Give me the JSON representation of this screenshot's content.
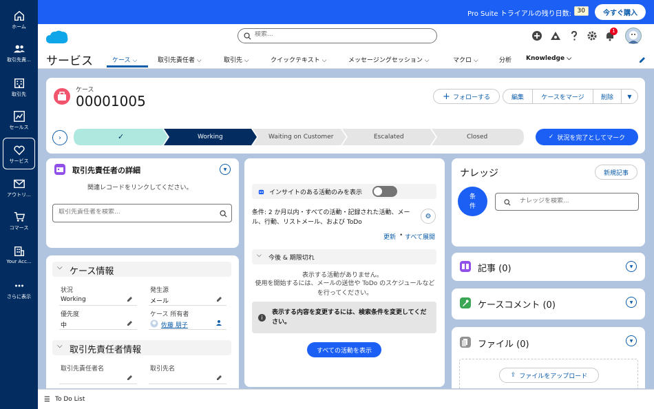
{
  "rail": {
    "items": [
      {
        "label": "ホーム",
        "icon": "home-icon"
      },
      {
        "label": "取引先責...",
        "icon": "contacts-icon"
      },
      {
        "label": "取引先",
        "icon": "accounts-icon"
      },
      {
        "label": "セールス",
        "icon": "sales-chart-icon"
      },
      {
        "label": "サービス",
        "icon": "heart-icon"
      },
      {
        "label": "アウトリ...",
        "icon": "mail-icon"
      },
      {
        "label": "コマース",
        "icon": "cart-icon"
      },
      {
        "label": "Your Acc...",
        "icon": "building-icon"
      },
      {
        "label": "さらに表示",
        "icon": "more-icon"
      }
    ]
  },
  "banner": {
    "trial_text": "Pro Suite トライアルの残り日数:",
    "trial_days": "30",
    "buy_label": "今すぐ購入"
  },
  "header": {
    "search_placeholder": "検索...",
    "app_name": "サービス",
    "tabs": [
      {
        "label": "ケース",
        "has_menu": true
      },
      {
        "label": "取引先責任者",
        "has_menu": true
      },
      {
        "label": "取引先",
        "has_menu": true
      },
      {
        "label": "クイックテキスト",
        "has_menu": true
      },
      {
        "label": "メッセージングセッション",
        "has_menu": true
      },
      {
        "label": "マクロ",
        "has_menu": true
      },
      {
        "label": "分析",
        "has_menu": false
      },
      {
        "label": "Knowledge",
        "has_menu": true
      }
    ],
    "notification_count": "1"
  },
  "record": {
    "object_label": "ケース",
    "number": "00001005",
    "follow_label": "フォローする",
    "edit_label": "編集",
    "merge_label": "ケースをマージ",
    "delete_label": "削除"
  },
  "path": {
    "steps": [
      "Working",
      "Waiting on Customer",
      "Escalated",
      "Closed"
    ],
    "complete_label": "状況を完了としてマーク"
  },
  "contact_details": {
    "title": "取引先責任者の詳細",
    "hint": "関連レコードをリンクしてください。",
    "search_placeholder": "取引先責任者を検索..."
  },
  "case_info": {
    "title": "ケース情報",
    "fields": [
      {
        "label": "状況",
        "value": "Working"
      },
      {
        "label": "発生源",
        "value": "メール"
      },
      {
        "label": "優先度",
        "value": "中"
      },
      {
        "label": "ケース 所有者",
        "value": "佐藤 朋子"
      }
    ]
  },
  "contact_info": {
    "title": "取引先責任者情報",
    "fields": [
      {
        "label": "取引先責任者名",
        "value": ""
      },
      {
        "label": "取引先名",
        "value": ""
      }
    ]
  },
  "activity": {
    "insight_toggle_label": "インサイトのある活動のみを表示",
    "filter_text": "条件: 2 か月以内・すべての活動・記録された活動、メール、行動、リストメール、および ToDo",
    "refresh_label": "更新",
    "dot": "•",
    "expand_label": "すべて展開",
    "upcoming_label": "今後 & 期限切れ",
    "empty_title": "表示する活動がありません。",
    "empty_sub": "使用を開始するには、メールの送信や ToDo のスケジュールなどを行ってください。",
    "info_text": "表示する内容を変更するには、検索条件を変更してください。",
    "show_all_label": "すべての活動を表示"
  },
  "knowledge": {
    "title": "ナレッジ",
    "new_label": "新規記事",
    "filter_label": "条件",
    "search_placeholder": "ナレッジを検索..."
  },
  "related": {
    "articles": "記事 (0)",
    "comments": "ケースコメント (0)",
    "files": "ファイル (0)",
    "upload_label": "ファイルをアップロード"
  },
  "footer": {
    "todo_label": "To Do List"
  },
  "colors": {
    "rail": "#032d60",
    "banner": "#1b5ff5",
    "brand": "#0b5cab",
    "path_done": "#aee8de",
    "path_current": "#032d60",
    "path_todo": "#e5e5e5"
  }
}
